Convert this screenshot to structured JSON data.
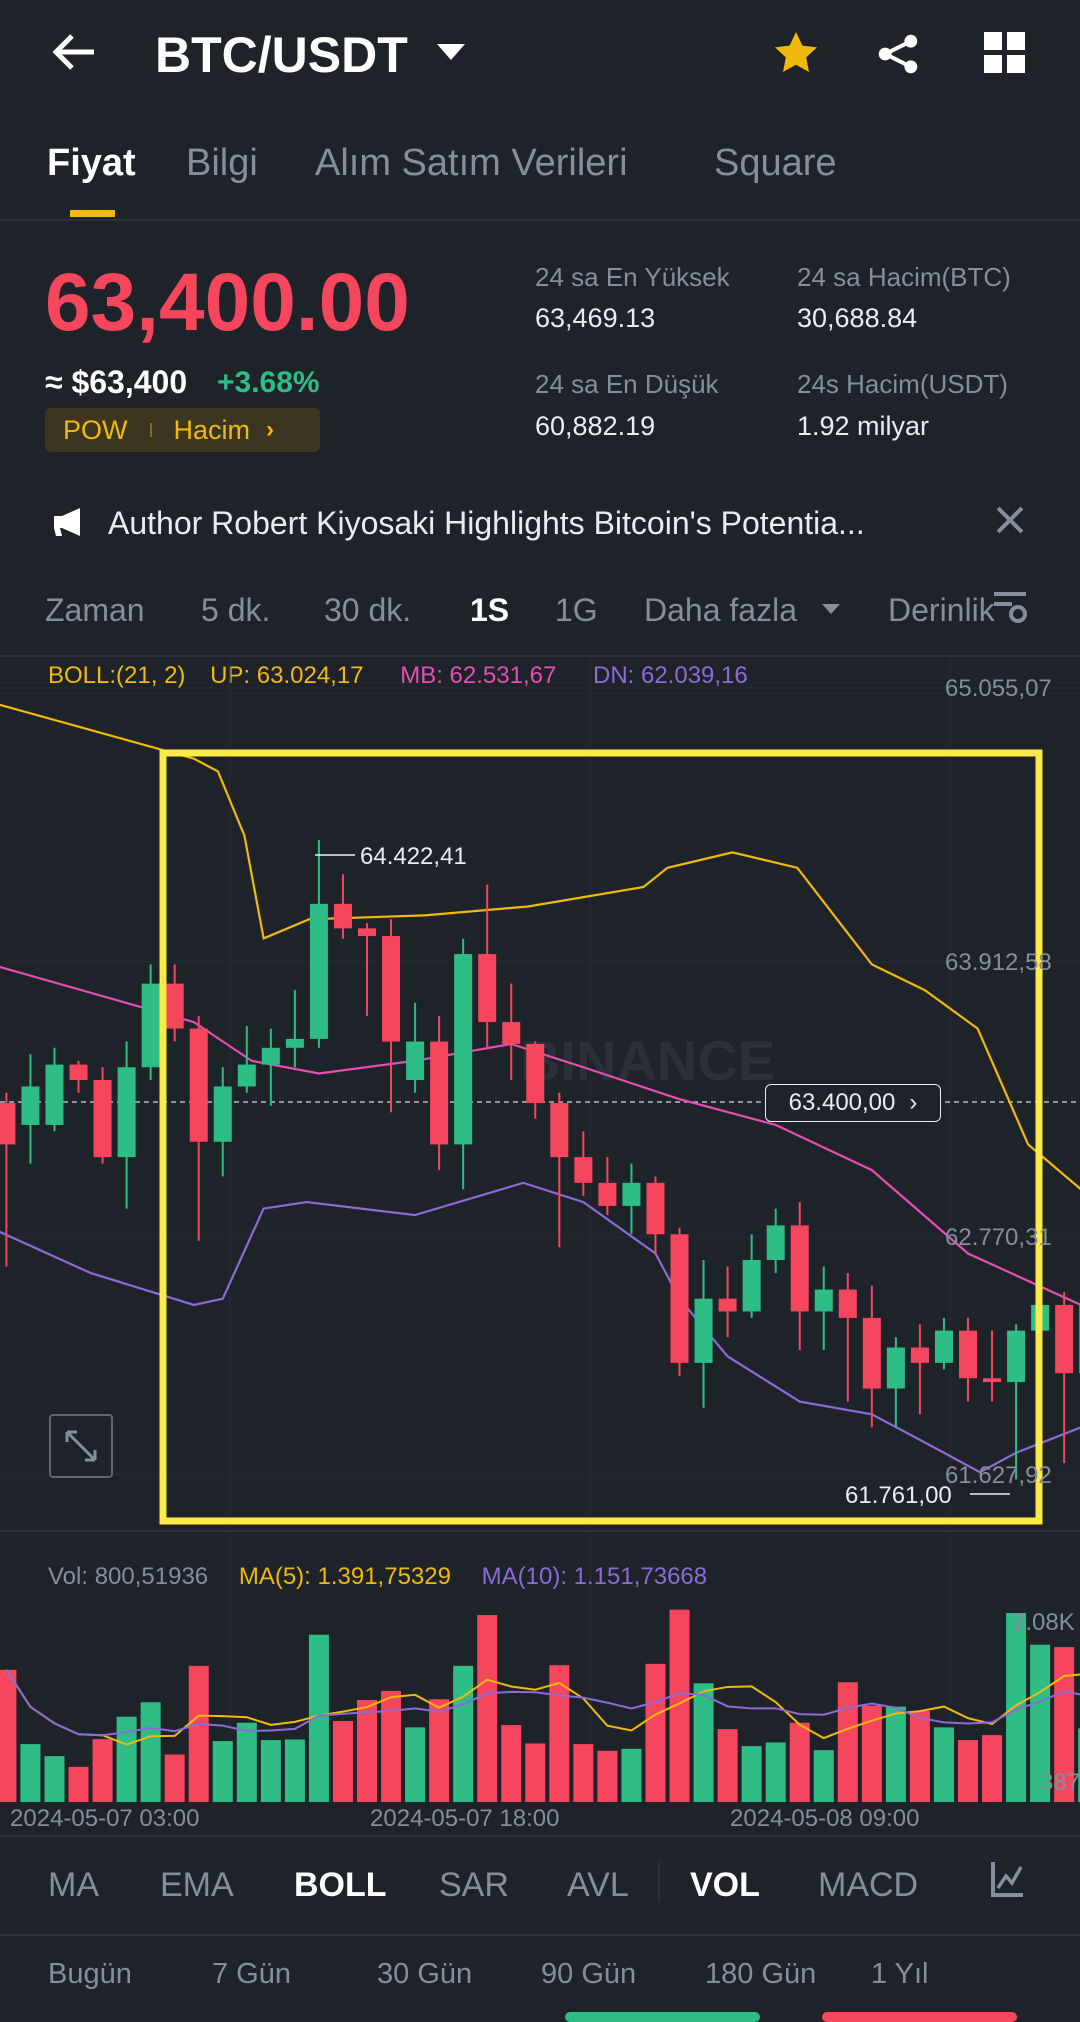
{
  "header": {
    "title": "BTC/USDT",
    "icons": [
      "back-arrow-icon",
      "chevron-down-icon",
      "star-icon",
      "share-icon",
      "grid-icon"
    ]
  },
  "tabs": [
    "Fiyat",
    "Bilgi",
    "Alım Satım Verileri",
    "Square"
  ],
  "price": {
    "last": "63,400.00",
    "usd": "≈ $63,400",
    "change": "+3.68%",
    "tag1": "POW",
    "tag2": "Hacim"
  },
  "stats": {
    "high_label": "24 sa En Yüksek",
    "high": "63,469.13",
    "low_label": "24 sa En Düşük",
    "low": "60,882.19",
    "vol_btc_label": "24 sa Hacim(BTC)",
    "vol_btc": "30,688.84",
    "vol_usdt_label": "24s Hacim(USDT)",
    "vol_usdt": "1.92 milyar"
  },
  "news": "Author Robert Kiyosaki Highlights Bitcoin's Potentia...",
  "intervals": [
    "Zaman",
    "5 dk.",
    "30 dk.",
    "1S",
    "1G",
    "Daha fazla",
    "Derinlik"
  ],
  "boll_legend": {
    "boll": "BOLL:(21, 2)",
    "up": "UP: 63.024,17",
    "mb": "MB: 62.531,67",
    "dn": "DN: 62.039,16"
  },
  "price_axis": [
    "65.055,07",
    "63.912,58",
    "62.770,31",
    "61.627,92"
  ],
  "current_price_tag": "63.400,00",
  "high_marker": "64.422,41",
  "low_marker": "61.761,00",
  "watermark": "BINANCE",
  "vol_legend": {
    "vol": "Vol: 800,51936",
    "ma5": "MA(5): 1.391,75329",
    "ma10": "MA(10): 1.151,73668"
  },
  "vol_axis": [
    "2.08K",
    "387"
  ],
  "time_axis": [
    "2024-05-07 03:00",
    "2024-05-07 18:00",
    "2024-05-08 09:00"
  ],
  "indicators": [
    "MA",
    "EMA",
    "BOLL",
    "SAR",
    "AVL",
    "VOL",
    "MACD"
  ],
  "ranges": [
    "Bugün",
    "7 Gün",
    "30 Gün",
    "90 Gün",
    "180 Gün",
    "1 Yıl"
  ],
  "colors": {
    "up": "#2EBD85",
    "down": "#F6465D",
    "accent": "#F0B90B",
    "mb": "#E34FB4",
    "dn": "#8C6BD6",
    "highlight": "#FFEB3B"
  },
  "chart_data": {
    "type": "candlestick",
    "title": "BTC/USDT 1S",
    "ylim": [
      61627.92,
      65055.07
    ],
    "candles": [
      [
        63327,
        63370,
        62647,
        63155
      ],
      [
        63236,
        63530,
        63075,
        63396
      ],
      [
        63236,
        63557,
        63209,
        63487
      ],
      [
        63487,
        63503,
        63370,
        63423
      ],
      [
        63423,
        63476,
        63075,
        63102
      ],
      [
        63102,
        63583,
        62888,
        63476
      ],
      [
        63476,
        63904,
        63423,
        63824
      ],
      [
        63824,
        63904,
        63583,
        63637
      ],
      [
        63637,
        63690,
        62754,
        63166
      ],
      [
        63166,
        63476,
        63022,
        63396
      ],
      [
        63396,
        63648,
        63370,
        63487
      ],
      [
        63487,
        63637,
        63316,
        63557
      ],
      [
        63557,
        63797,
        63476,
        63594
      ],
      [
        63594,
        64422,
        63557,
        64156
      ],
      [
        64156,
        64279,
        64011,
        64054
      ],
      [
        64054,
        64076,
        63690,
        64022
      ],
      [
        64022,
        64092,
        63289,
        63583
      ],
      [
        63423,
        63744,
        63370,
        63583
      ],
      [
        63583,
        63690,
        63048,
        63155
      ],
      [
        63155,
        64011,
        62968,
        63947
      ],
      [
        63947,
        64236,
        63557,
        63664
      ],
      [
        63664,
        63824,
        63423,
        63573
      ],
      [
        63573,
        63583,
        63262,
        63327
      ],
      [
        63327,
        63370,
        62727,
        63102
      ],
      [
        63102,
        63209,
        62941,
        62995
      ],
      [
        62995,
        63102,
        62861,
        62899
      ],
      [
        62899,
        63075,
        62781,
        62995
      ],
      [
        62995,
        63022,
        62701,
        62781
      ],
      [
        62781,
        62808,
        62192,
        62246
      ],
      [
        62246,
        62674,
        62059,
        62513
      ],
      [
        62513,
        62647,
        62353,
        62460
      ],
      [
        62460,
        62781,
        62433,
        62674
      ],
      [
        62674,
        62888,
        62620,
        62818
      ],
      [
        62818,
        62915,
        62299,
        62460
      ],
      [
        62460,
        62647,
        62299,
        62551
      ],
      [
        62551,
        62620,
        62085,
        62433
      ],
      [
        62433,
        62567,
        61978,
        62139
      ],
      [
        62139,
        62353,
        61978,
        62310
      ],
      [
        62310,
        62406,
        62032,
        62246
      ],
      [
        62246,
        62433,
        62219,
        62380
      ],
      [
        62380,
        62433,
        62085,
        62182
      ],
      [
        62182,
        62380,
        62085,
        62166
      ],
      [
        62166,
        62406,
        61761,
        62380
      ],
      [
        62380,
        62513,
        62353,
        62487
      ],
      [
        62487,
        62540,
        61829,
        62203
      ],
      [
        62203,
        62540,
        62150,
        62487
      ]
    ],
    "boll": {
      "up": [
        [
          -0.3,
          64985
        ],
        [
          7.8,
          64760
        ],
        [
          8.8,
          64707
        ],
        [
          9.9,
          64440
        ],
        [
          10.7,
          64012
        ],
        [
          12.6,
          64092
        ],
        [
          17.4,
          64108
        ],
        [
          21.7,
          64145
        ],
        [
          26.5,
          64226
        ],
        [
          27.5,
          64306
        ],
        [
          30.2,
          64370
        ],
        [
          32.9,
          64306
        ],
        [
          36,
          63904
        ],
        [
          38.2,
          63797
        ],
        [
          40.4,
          63637
        ],
        [
          42.5,
          63155
        ],
        [
          44.7,
          62968
        ]
      ],
      "mb": [
        [
          -0.3,
          63894
        ],
        [
          7.8,
          63664
        ],
        [
          10.2,
          63503
        ],
        [
          13,
          63450
        ],
        [
          17,
          63503
        ],
        [
          21,
          63573
        ],
        [
          24,
          63476
        ],
        [
          28,
          63343
        ],
        [
          32,
          63236
        ],
        [
          36,
          63048
        ],
        [
          40,
          62701
        ],
        [
          44.7,
          62487
        ]
      ],
      "dn": [
        [
          -0.3,
          62792
        ],
        [
          3.5,
          62620
        ],
        [
          7.8,
          62487
        ],
        [
          9,
          62513
        ],
        [
          10.7,
          62888
        ],
        [
          12.5,
          62915
        ],
        [
          17,
          62861
        ],
        [
          21.5,
          62995
        ],
        [
          24,
          62915
        ],
        [
          27,
          62701
        ],
        [
          28,
          62513
        ],
        [
          30,
          62273
        ],
        [
          33,
          62085
        ],
        [
          36,
          62032
        ],
        [
          39,
          61872
        ],
        [
          40.5,
          61791
        ],
        [
          42,
          61872
        ],
        [
          44.7,
          61978
        ]
      ]
    },
    "volume": [
      1454,
      637,
      504,
      386,
      692,
      938,
      1097,
      523,
      1498,
      670,
      872,
      681,
      688,
      1840,
      891,
      1122,
      1222,
      821,
      1130,
      1498,
      2057,
      846,
      644,
      1505,
      637,
      563,
      585,
      1520,
      2116,
      1306,
      802,
      615,
      655,
      872,
      570,
      1317,
      1060,
      1049,
      1001,
      821,
      681,
      736,
      2079,
      1730,
      1704,
      810
    ],
    "volume_ma_periods": [
      5,
      10
    ]
  }
}
